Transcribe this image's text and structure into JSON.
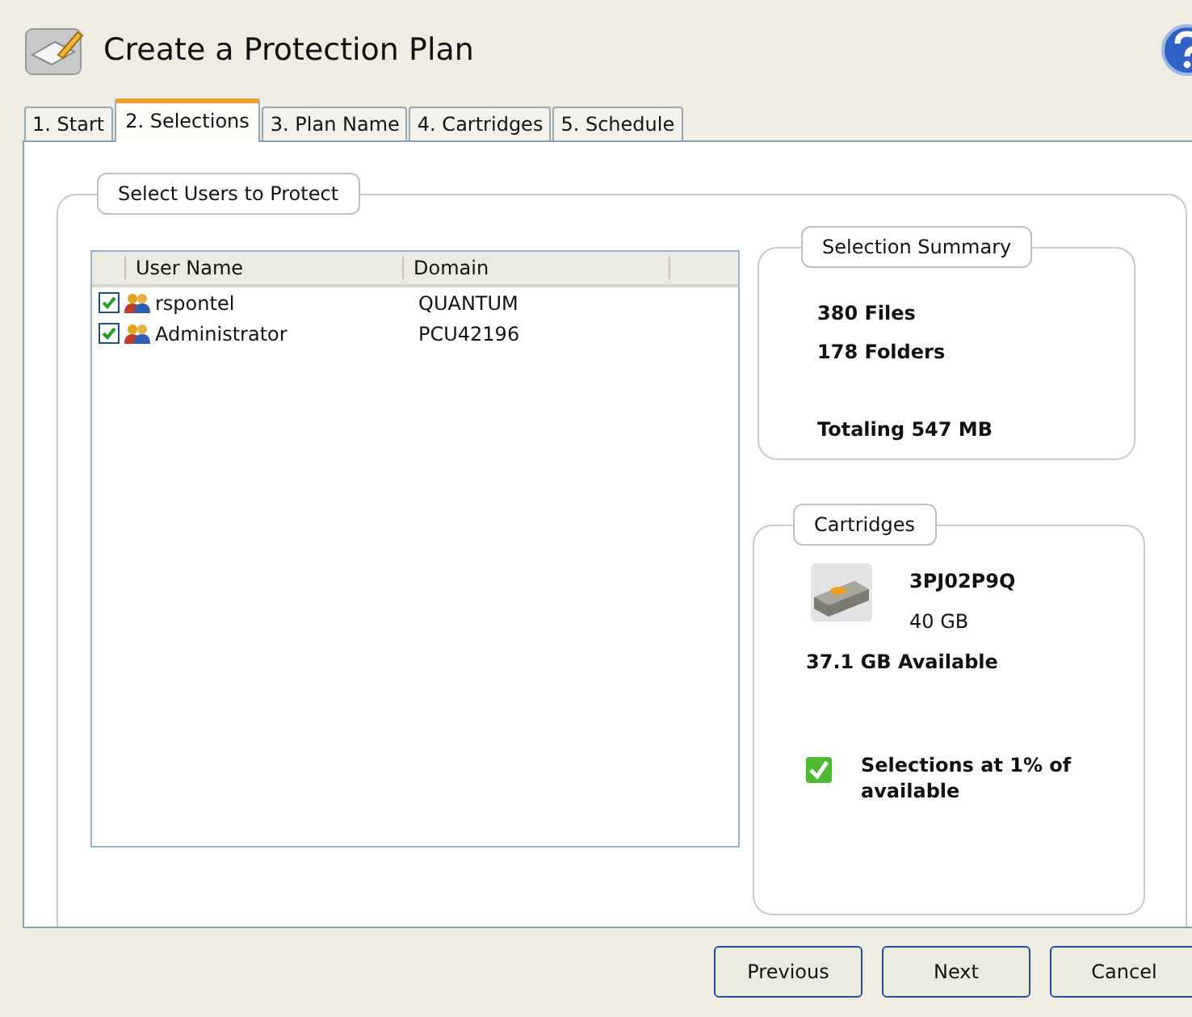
{
  "window": {
    "title": "Create a Protection Plan"
  },
  "tabs": [
    {
      "label": "1. Start",
      "selected": false
    },
    {
      "label": "2. Selections",
      "selected": true
    },
    {
      "label": "3. Plan Name",
      "selected": false
    },
    {
      "label": "4. Cartridges",
      "selected": false
    },
    {
      "label": "5. Schedule",
      "selected": false
    }
  ],
  "users_group": {
    "title": "Select Users to Protect",
    "columns": [
      "User Name",
      "Domain"
    ],
    "rows": [
      {
        "user": "rspontel",
        "domain": "QUANTUM",
        "checked": true
      },
      {
        "user": "Administrator",
        "domain": "PCU42196",
        "checked": true
      }
    ]
  },
  "summary": {
    "title": "Selection Summary",
    "files": "380 Files",
    "folders": "178 Folders",
    "total": "Totaling 547 MB"
  },
  "cartridges": {
    "title": "Cartridges",
    "name": "3PJ02P9Q",
    "capacity": "40 GB",
    "available": "37.1 GB Available",
    "status_ok": true,
    "status": "Selections at 1% of available"
  },
  "buttons": [
    "Previous",
    "Next",
    "Cancel"
  ]
}
